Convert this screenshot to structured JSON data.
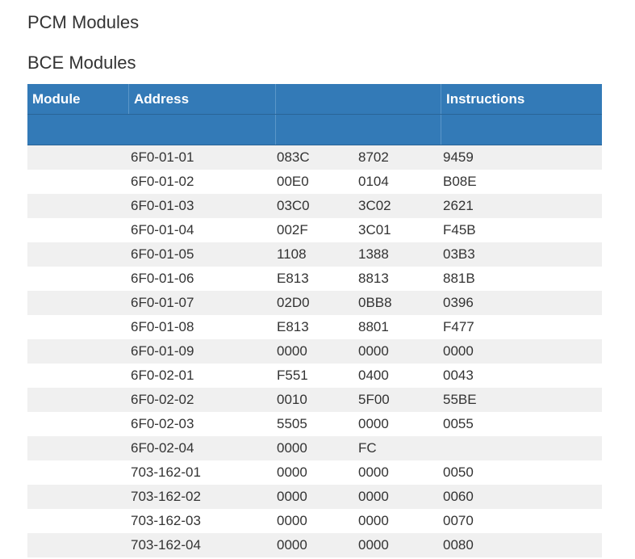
{
  "headings": {
    "pcm": "PCM Modules",
    "bce": "BCE Modules"
  },
  "table": {
    "columns": [
      "Module",
      "Address",
      "",
      "Instructions"
    ],
    "rows": [
      {
        "module": "",
        "address": "6F0-01-01",
        "v1": "083C",
        "v2": "8702",
        "v3": "9459"
      },
      {
        "module": "",
        "address": "6F0-01-02",
        "v1": "00E0",
        "v2": "0104",
        "v3": "B08E"
      },
      {
        "module": "",
        "address": "6F0-01-03",
        "v1": "03C0",
        "v2": "3C02",
        "v3": "2621"
      },
      {
        "module": "",
        "address": "6F0-01-04",
        "v1": "002F",
        "v2": "3C01",
        "v3": "F45B"
      },
      {
        "module": "",
        "address": "6F0-01-05",
        "v1": "1108",
        "v2": "1388",
        "v3": "03B3"
      },
      {
        "module": "",
        "address": "6F0-01-06",
        "v1": "E813",
        "v2": "8813",
        "v3": "881B"
      },
      {
        "module": "",
        "address": "6F0-01-07",
        "v1": "02D0",
        "v2": "0BB8",
        "v3": "0396"
      },
      {
        "module": "",
        "address": "6F0-01-08",
        "v1": "E813",
        "v2": "8801",
        "v3": "F477"
      },
      {
        "module": "",
        "address": "6F0-01-09",
        "v1": "0000",
        "v2": "0000",
        "v3": "0000"
      },
      {
        "module": "",
        "address": "6F0-02-01",
        "v1": "F551",
        "v2": "0400",
        "v3": "0043"
      },
      {
        "module": "",
        "address": "6F0-02-02",
        "v1": "0010",
        "v2": "5F00",
        "v3": "55BE"
      },
      {
        "module": "",
        "address": "6F0-02-03",
        "v1": "5505",
        "v2": "0000",
        "v3": "0055"
      },
      {
        "module": "",
        "address": "6F0-02-04",
        "v1": "0000",
        "v2": "FC",
        "v3": ""
      },
      {
        "module": "",
        "address": "703-162-01",
        "v1": "0000",
        "v2": "0000",
        "v3": "0050"
      },
      {
        "module": "",
        "address": "703-162-02",
        "v1": "0000",
        "v2": "0000",
        "v3": "0060"
      },
      {
        "module": "",
        "address": "703-162-03",
        "v1": "0000",
        "v2": "0000",
        "v3": "0070"
      },
      {
        "module": "",
        "address": "703-162-04",
        "v1": "0000",
        "v2": "0000",
        "v3": "0080"
      }
    ]
  },
  "colors": {
    "header_bg": "#337ab7",
    "stripe_bg": "#f0f0f0"
  }
}
